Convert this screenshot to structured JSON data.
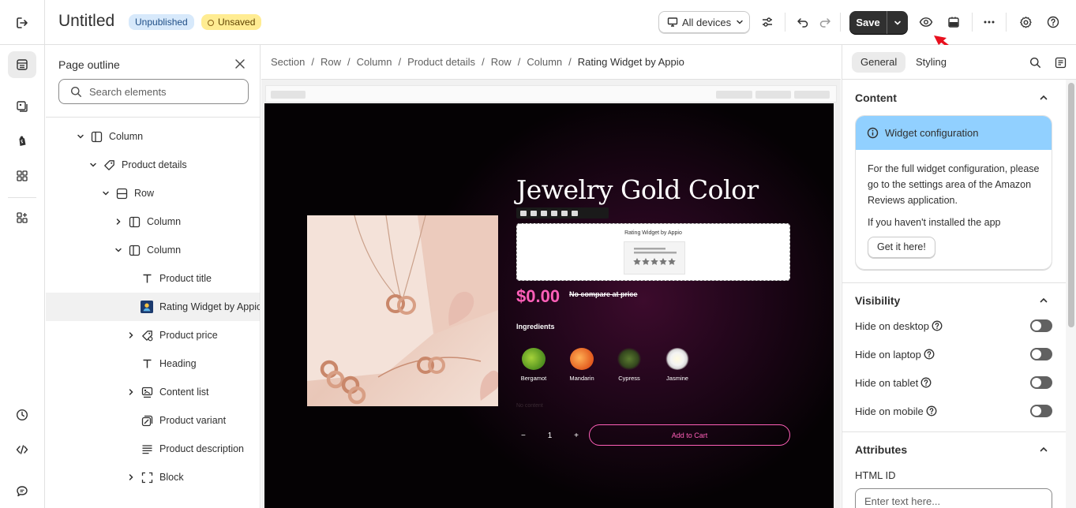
{
  "topbar": {
    "title": "Untitled",
    "badge_unpublished": "Unpublished",
    "badge_unsaved": "Unsaved",
    "device_select": "All devices",
    "save_label": "Save"
  },
  "outline": {
    "title": "Page outline",
    "search_placeholder": "Search elements",
    "items": [
      {
        "label": "Column"
      },
      {
        "label": "Product details"
      },
      {
        "label": "Row"
      },
      {
        "label": "Column"
      },
      {
        "label": "Column"
      },
      {
        "label": "Product title"
      },
      {
        "label": "Rating Widget by Appio"
      },
      {
        "label": "Product price"
      },
      {
        "label": "Heading"
      },
      {
        "label": "Content list"
      },
      {
        "label": "Product variant"
      },
      {
        "label": "Product description"
      },
      {
        "label": "Block"
      }
    ]
  },
  "breadcrumb": [
    "Section",
    "Row",
    "Column",
    "Product details",
    "Row",
    "Column",
    "Rating Widget by Appio"
  ],
  "preview": {
    "product_title": "Jewelry Gold Color",
    "widget_label": "Rating Widget by Appio",
    "price": "$0.00",
    "compare_price": "No compare at price",
    "ingredients_title": "Ingredients",
    "ingredients": [
      "Bergamot",
      "Mandarin",
      "Cypress",
      "Jasmine"
    ],
    "no_content": "No content",
    "quantity": "1",
    "minus": "−",
    "plus": "+",
    "add_to_cart": "Add to Cart"
  },
  "settings": {
    "tab_general": "General",
    "tab_styling": "Styling",
    "content_title": "Content",
    "callout_title": "Widget configuration",
    "callout_text": "For the full widget configuration, please go to the settings area of the Amazon Reviews application.",
    "callout_text2": "If you haven't installed the app",
    "get_button": "Get it here!",
    "visibility_title": "Visibility",
    "vis_items": [
      "Hide on desktop",
      "Hide on laptop",
      "Hide on tablet",
      "Hide on mobile"
    ],
    "attributes_title": "Attributes",
    "html_id_label": "HTML ID",
    "html_id_placeholder": "Enter text here..."
  },
  "colors": {
    "accent_pink": "#ff5fb8",
    "callout_blue": "#91d0ff",
    "save_dark": "#303030",
    "annotation_arrow": "#e8101e"
  }
}
